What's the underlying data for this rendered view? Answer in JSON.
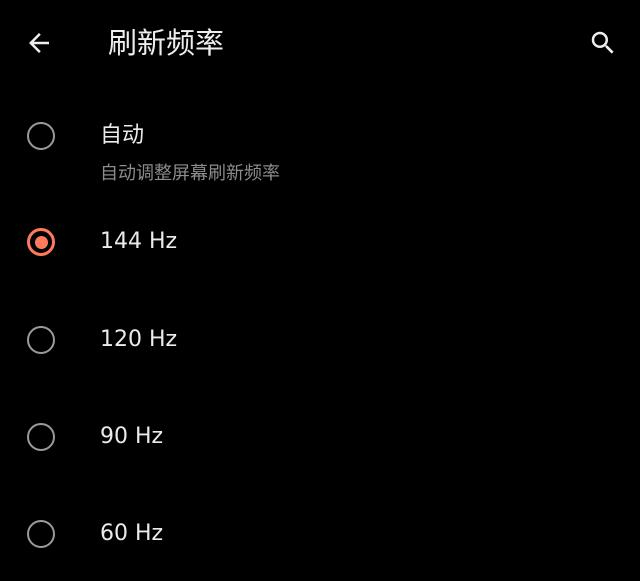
{
  "header": {
    "title": "刷新频率",
    "back_icon": "arrow-left-icon",
    "search_icon": "search-icon"
  },
  "options": [
    {
      "label": "自动",
      "summary": "自动调整屏幕刷新频率",
      "selected": false
    },
    {
      "label": "144 Hz",
      "selected": true
    },
    {
      "label": "120 Hz",
      "selected": false
    },
    {
      "label": "90 Hz",
      "selected": false
    },
    {
      "label": "60 Hz",
      "selected": false
    }
  ],
  "colors": {
    "background": "#000000",
    "accent": "#ff7a5c",
    "text_primary": "#ebebeb",
    "text_secondary": "#8c8c8c",
    "radio_unchecked": "#9a9a9a"
  }
}
